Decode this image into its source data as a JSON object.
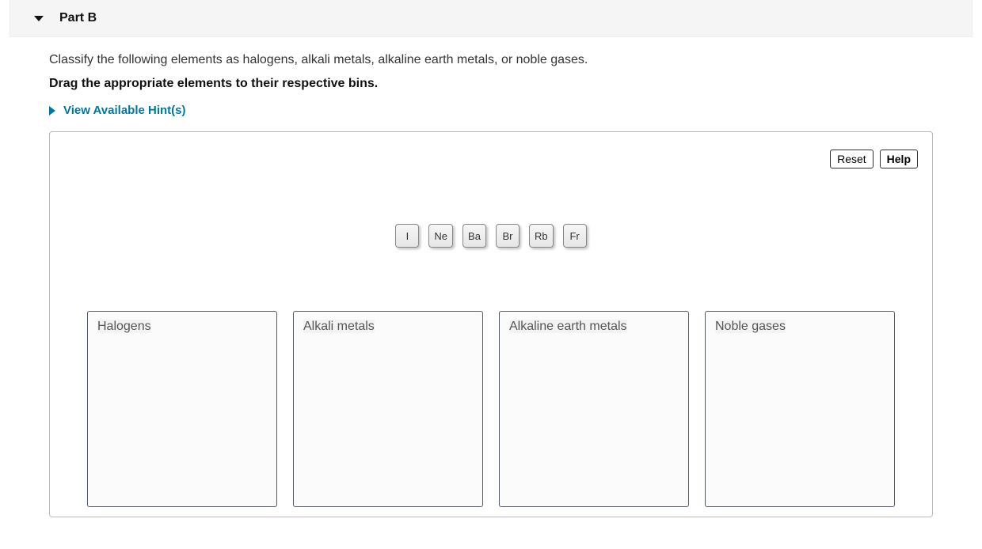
{
  "part": {
    "label": "Part B"
  },
  "instructions": {
    "main": "Classify the following elements as halogens, alkali metals, alkaline earth metals, or noble gases.",
    "drag": "Drag the appropriate elements to their respective bins."
  },
  "hints": {
    "toggle_label": "View Available Hint(s)"
  },
  "workspace": {
    "buttons": {
      "reset": "Reset",
      "help": "Help"
    },
    "elements": [
      "I",
      "Ne",
      "Ba",
      "Br",
      "Rb",
      "Fr"
    ],
    "bins": [
      {
        "label": "Halogens"
      },
      {
        "label": "Alkali metals"
      },
      {
        "label": "Alkaline earth metals"
      },
      {
        "label": "Noble gases"
      }
    ]
  }
}
